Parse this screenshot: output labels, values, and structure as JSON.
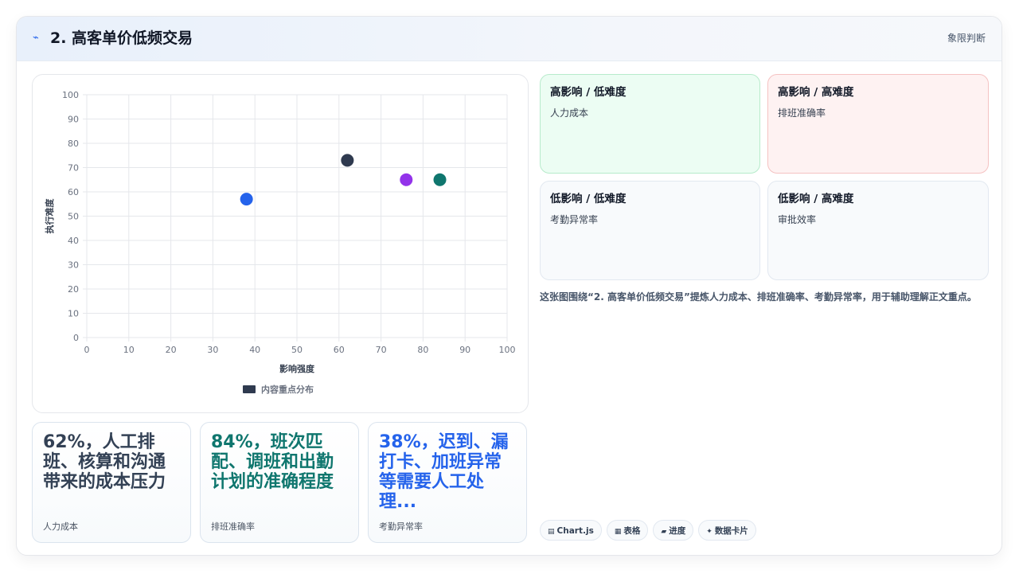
{
  "header": {
    "icon": "⌁",
    "title": "2. 高客单价低频交易",
    "tag": "象限判断"
  },
  "chart_data": {
    "type": "scatter",
    "xlabel": "影响强度",
    "ylabel": "执行难度",
    "xlim": [
      0,
      100
    ],
    "ylim": [
      0,
      100
    ],
    "xticks": [
      0,
      10,
      20,
      30,
      40,
      50,
      60,
      70,
      80,
      90,
      100
    ],
    "yticks": [
      0,
      10,
      20,
      30,
      40,
      50,
      60,
      70,
      80,
      90,
      100
    ],
    "grid": true,
    "legend_position": "bottom",
    "series": [
      {
        "name": "内容重点分布",
        "color": "#2f3a4f",
        "points": [
          {
            "x": 38,
            "y": 57,
            "color": "#2563eb"
          },
          {
            "x": 62,
            "y": 73,
            "color": "#2f3a4f"
          },
          {
            "x": 76,
            "y": 65,
            "color": "#9333ea"
          },
          {
            "x": 84,
            "y": 65,
            "color": "#0f766e"
          }
        ]
      }
    ]
  },
  "quadrants": [
    {
      "title": "高影响 / 低难度",
      "item": "人力成本",
      "style": "green"
    },
    {
      "title": "高影响 / 高难度",
      "item": "排班准确率",
      "style": "red"
    },
    {
      "title": "低影响 / 低难度",
      "item": "考勤异常率",
      "style": "plain"
    },
    {
      "title": "低影响 / 高难度",
      "item": "审批效率",
      "style": "plain"
    }
  ],
  "description": "这张图围绕“2. 高客单价低频交易”提炼人力成本、排班准确率、考勤异常率，用于辅助理解正文重点。",
  "stats": [
    {
      "value": "62%，人工排班、核算和沟通带来的成本压力",
      "label": "人力成本",
      "color": "#334155"
    },
    {
      "value": "84%，班次匹配、调班和出勤计划的准确程度",
      "label": "排班准确率",
      "color": "#0f766e"
    },
    {
      "value": "38%，迟到、漏打卡、加班异常等需要人工处理...",
      "label": "考勤异常率",
      "color": "#2563eb"
    }
  ],
  "chips": [
    {
      "icon": "▤",
      "label": "Chart.js"
    },
    {
      "icon": "▦",
      "label": "表格"
    },
    {
      "icon": "▰",
      "label": "进度"
    },
    {
      "icon": "✦",
      "label": "数据卡片"
    }
  ]
}
